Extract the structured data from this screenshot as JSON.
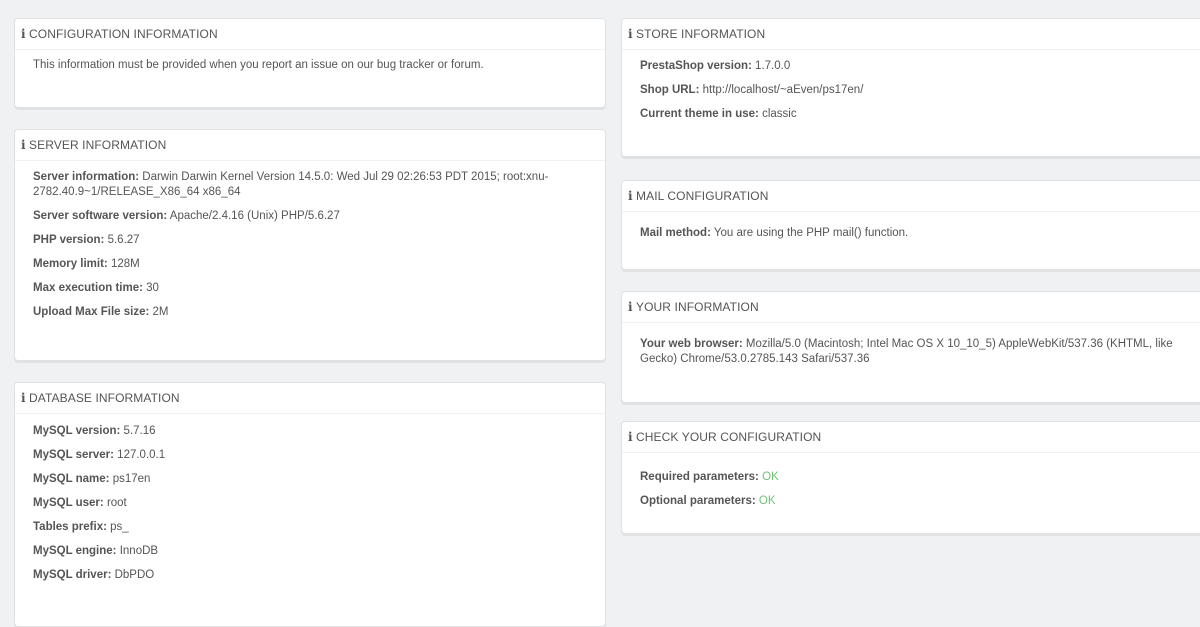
{
  "config": {
    "title": "CONFIGURATION INFORMATION",
    "text": "This information must be provided when you report an issue on our bug tracker or forum."
  },
  "server": {
    "title": "SERVER INFORMATION",
    "rows": [
      {
        "label": "Server information:",
        "value": "Darwin Darwin Kernel Version 14.5.0: Wed Jul 29 02:26:53 PDT 2015; root:xnu-2782.40.9~1/RELEASE_X86_64 x86_64"
      },
      {
        "label": "Server software version:",
        "value": "Apache/2.4.16 (Unix) PHP/5.6.27"
      },
      {
        "label": "PHP version:",
        "value": "5.6.27"
      },
      {
        "label": "Memory limit:",
        "value": "128M"
      },
      {
        "label": "Max execution time:",
        "value": "30"
      },
      {
        "label": "Upload Max File size:",
        "value": "2M"
      }
    ]
  },
  "database": {
    "title": "DATABASE INFORMATION",
    "rows": [
      {
        "label": "MySQL version:",
        "value": "5.7.16"
      },
      {
        "label": "MySQL server:",
        "value": "127.0.0.1"
      },
      {
        "label": "MySQL name:",
        "value": "ps17en"
      },
      {
        "label": "MySQL user:",
        "value": "root"
      },
      {
        "label": "Tables prefix:",
        "value": "ps_"
      },
      {
        "label": "MySQL engine:",
        "value": "InnoDB"
      },
      {
        "label": "MySQL driver:",
        "value": "DbPDO"
      }
    ]
  },
  "store": {
    "title": "STORE INFORMATION",
    "rows": [
      {
        "label": "PrestaShop version:",
        "value": "1.7.0.0"
      },
      {
        "label": "Shop URL:",
        "value": "http://localhost/~aEven/ps17en/"
      },
      {
        "label": "Current theme in use:",
        "value": "classic"
      }
    ]
  },
  "mail": {
    "title": "MAIL CONFIGURATION",
    "rows": [
      {
        "label": "Mail method:",
        "value": "You are using the PHP mail() function."
      }
    ]
  },
  "you": {
    "title": "YOUR INFORMATION",
    "rows": [
      {
        "label": "Your web browser:",
        "value": "Mozilla/5.0 (Macintosh; Intel Mac OS X 10_10_5) AppleWebKit/537.36 (KHTML, like Gecko) Chrome/53.0.2785.143 Safari/537.36"
      }
    ]
  },
  "check": {
    "title": "CHECK YOUR CONFIGURATION",
    "rows": [
      {
        "label": "Required parameters:",
        "value": "OK"
      },
      {
        "label": "Optional parameters:",
        "value": "OK"
      }
    ]
  },
  "colors": {
    "background": "#eff1f2",
    "panel": "#ffffff",
    "ok_green": "#72c279",
    "text": "#555555"
  },
  "icons": {
    "panel_heading": "info-icon"
  }
}
